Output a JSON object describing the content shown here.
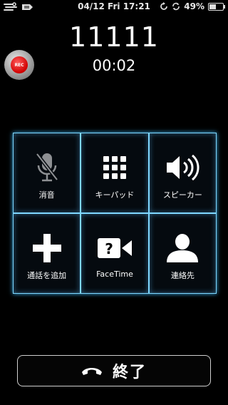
{
  "status_bar": {
    "clock": "04/12 Fri 17:21",
    "battery_percent_text": "49%",
    "battery_level": 0.49
  },
  "call": {
    "number": "11111",
    "timer": "00:02"
  },
  "rec": {
    "label": "REC"
  },
  "keypad": [
    {
      "label": "消音",
      "icon": "mute-mic-icon"
    },
    {
      "label": "キーパッド",
      "icon": "keypad-icon"
    },
    {
      "label": "スピーカー",
      "icon": "speaker-icon"
    },
    {
      "label": "通話を追加",
      "icon": "add-call-icon"
    },
    {
      "label": "FaceTime",
      "icon": "facetime-icon"
    },
    {
      "label": "連絡先",
      "icon": "contacts-icon"
    }
  ],
  "end_call": {
    "label": "終了",
    "icon": "hang-up-icon"
  },
  "colors": {
    "accent_glow": "#7fd8ff",
    "rec_red": "#d10000"
  }
}
